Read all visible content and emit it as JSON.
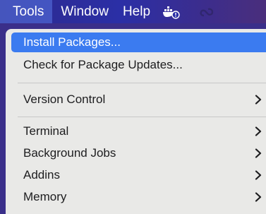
{
  "menubar": {
    "items": [
      {
        "label": "Tools"
      },
      {
        "label": "Window"
      },
      {
        "label": "Help"
      }
    ],
    "status_icons": [
      "docker-warning-icon",
      "creative-cloud-icon"
    ]
  },
  "menu": {
    "items": [
      {
        "label": "Install Packages...",
        "selected": true,
        "submenu": false
      },
      {
        "label": "Check for Package Updates...",
        "submenu": false
      },
      {
        "label": "Version Control",
        "submenu": true
      },
      {
        "label": "Terminal",
        "submenu": true
      },
      {
        "label": "Background Jobs",
        "submenu": true
      },
      {
        "label": "Addins",
        "submenu": true
      },
      {
        "label": "Memory",
        "submenu": true
      }
    ]
  },
  "colors": {
    "selection": "#3b7bf0",
    "menu_background": "#e9e9e7",
    "menubar": "#2b2fa6"
  }
}
